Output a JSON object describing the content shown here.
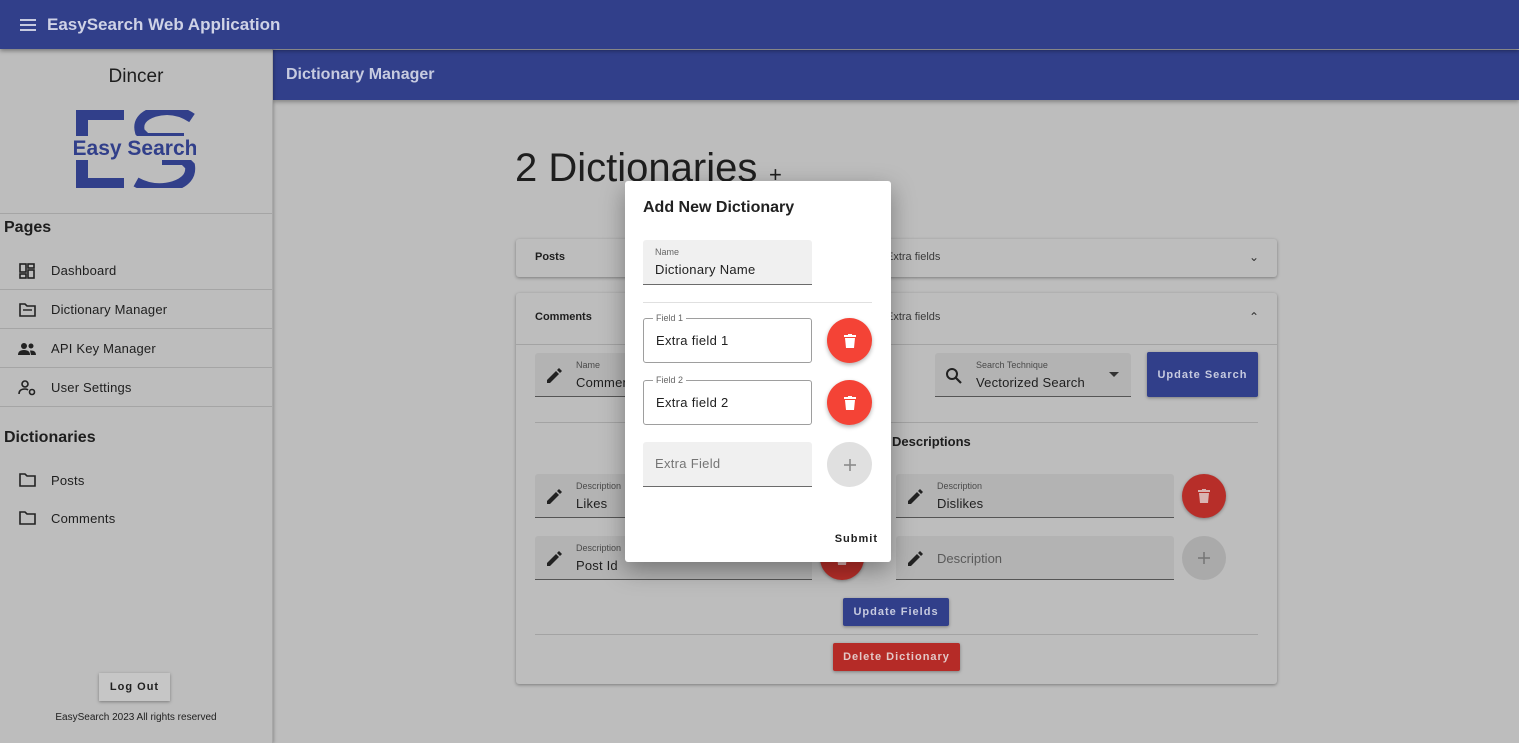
{
  "app": {
    "title": "EasySearch Web Application"
  },
  "drawer": {
    "user_name": "Dincer",
    "logo_text": "Easy Search",
    "pages_heading": "Pages",
    "pages": [
      {
        "label": "Dashboard",
        "icon": "dashboard-icon"
      },
      {
        "label": "Dictionary Manager",
        "icon": "folder-open-icon"
      },
      {
        "label": "API Key Manager",
        "icon": "people-icon"
      },
      {
        "label": "User Settings",
        "icon": "manage-accounts-icon"
      }
    ],
    "dictionaries_heading": "Dictionaries",
    "dictionaries": [
      {
        "label": "Posts",
        "icon": "folder-icon"
      },
      {
        "label": "Comments",
        "icon": "folder-icon"
      }
    ],
    "logout_label": "Log Out",
    "footer": "EasySearch 2023 All rights reserved"
  },
  "subbar": {
    "title": "Dictionary Manager"
  },
  "main": {
    "heading": "2 Dictionaries",
    "add_glyph": "+",
    "cards": [
      {
        "title": "Posts",
        "extra": "Extra fields",
        "expanded": false
      },
      {
        "title": "Comments",
        "extra": "Extra fields",
        "expanded": true
      }
    ],
    "comments": {
      "name_label": "Name",
      "name_value": "Comments",
      "search_label": "Search Technique",
      "search_value": "Vectorized Search",
      "update_search": "Update Search",
      "descriptions_heading": "Descriptions",
      "desc_label": "Description",
      "descriptions": [
        "Likes",
        "Dislikes",
        "Post Id"
      ],
      "desc_placeholder": "Description",
      "update_fields": "Update Fields",
      "delete_dictionary": "Delete Dictionary"
    }
  },
  "dialog": {
    "title": "Add New Dictionary",
    "name_label": "Name",
    "name_value": "Dictionary Name",
    "fields": [
      {
        "label": "Field 1",
        "value": "Extra field 1"
      },
      {
        "label": "Field 2",
        "value": "Extra field 2"
      }
    ],
    "extra_placeholder": "Extra Field",
    "submit": "Submit"
  },
  "colors": {
    "primary": "#313f8a",
    "danger": "#f44336",
    "dim_danger": "#b72e29"
  }
}
